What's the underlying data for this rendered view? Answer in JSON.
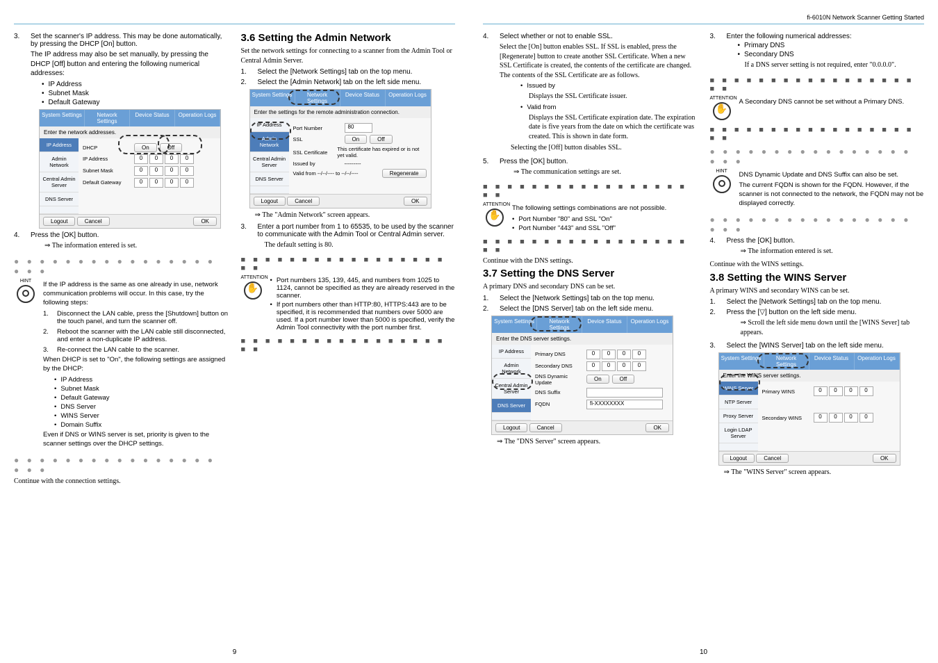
{
  "header_right": "fi-6010N Network Scanner Getting Started",
  "page_left_num": "9",
  "page_right_num": "10",
  "L": {
    "step3": "Set the scanner's IP address. This may be done automatically, by pressing the DHCP [On] button.",
    "step3_2": "The IP address may also be set manually, by pressing the DHCP [Off] button and entering the following numerical addresses:",
    "b_ip": "IP Address",
    "b_sm": "Subnet Mask",
    "b_dg": "Default Gateway",
    "ui1": {
      "tabs": [
        "System Settings",
        "Network Settings",
        "Device Status",
        "Operation Logs"
      ],
      "barmsg": "Enter the network addresses.",
      "side": [
        "IP Address",
        "Admin Network",
        "Central Admin Server",
        "DNS Server"
      ],
      "rows": {
        "dhcp": "DHCP",
        "on": "On",
        "off": "Off",
        "ipaddr": "IP Address",
        "subnet": "Subnet Mask",
        "defgw": "Default Gateway"
      },
      "logout": "Logout",
      "cancel": "Cancel",
      "ok": "OK",
      "zero": "0"
    },
    "step4": "Press the [OK] button.",
    "step4_arrow": "⇒ The information entered is set.",
    "hint_intro": "If the IP address is the same as one already in use, network communication problems will occur. In this case, try the following steps:",
    "hint1": "Disconnect the LAN cable, press the [Shutdown] button on the touch panel, and turn the scanner off.",
    "hint2": "Reboot the scanner with the LAN cable still disconnected, and enter a non-duplicate IP address.",
    "hint3": "Re-connect the LAN cable to the scanner.",
    "hint_d": "When DHCP is set to \"On\", the following settings are assigned by the DHCP:",
    "hb": [
      "IP Address",
      "Subnet Mask",
      "Default Gateway",
      "DNS Server",
      "WINS Server",
      "Domain Suffix"
    ],
    "hint_e": "Even if DNS or WINS server is set, priority is given to the scanner settings over the DHCP settings.",
    "cont1": "Continue with the connection settings.",
    "h36": "3.6  Setting the Admin Network",
    "h36_intro": "Set the network settings for connecting to a scanner from the Admin Tool or Central Admin Server.",
    "h36_s1": "Select the [Network Settings] tab on the top menu.",
    "h36_s2": "Select the [Admin Network] tab on the left side menu.",
    "ui2": {
      "barmsg": "Enter the settings for the remote administration connection.",
      "port": "Port Number",
      "port_v": "80",
      "ssl": "SSL",
      "on": "On",
      "off": "Off",
      "sslcert": "SSL Certificate",
      "sslcert_v": "This certificate has expired or is not yet valid.",
      "issued": "Issued by",
      "issued_v": "---------",
      "valid": "Valid from   --/--/----   to   --/--/----",
      "regen": "Regenerate"
    },
    "ui2_arrow": "⇒ The \"Admin Network\" screen appears.",
    "h36_s3": "Enter a port number from 1 to 65535, to be used by the scanner to communicate with the Admin Tool or Central Admin server.",
    "h36_def": "The default setting is 80.",
    "att1": "Port numbers 135, 139, 445, and numbers from 1025 to 1124, cannot be specified as they are already reserved in the scanner.",
    "att2": "If port numbers other than HTTP:80, HTTPS:443 are to be specified, it is recommended that numbers over 5000 are used. If a port number lower than 5000 is specified, verify the Admin Tool connectivity with the port number first."
  },
  "R": {
    "step4": "Select whether or not to enable SSL.",
    "step4_a": "Select the [On] button enables SSL. If SSL is enabled, press the [Regenerate] button to create another SSL Certificate. When a new SSL Certificate is created, the contents of the certificate are changed. The contents of the SSL Certificate are as follows.",
    "b_iss": "Issued by",
    "b_iss_t": "Displays the SSL Certificate issuer.",
    "b_val": "Valid from",
    "b_val_t": "Displays the SSL Certificate expiration date. The expiration date is five years from the date on which the certificate was created. This is shown in date form.",
    "sel_off": "Selecting the [Off] button disables SSL.",
    "step5": "Press the [OK] button.",
    "step5_arrow": "⇒ The communication settings are set.",
    "att_c": "The following settings combinations are not possible.",
    "att_c1": "Port Number \"80\" and SSL \"On\"",
    "att_c2": "Port Number \"443\" and SSL \"Off\"",
    "cont_dns": "Continue with the DNS settings.",
    "h37": "3.7  Setting the DNS Server",
    "h37_intro": "A primary DNS and secondary DNS can be set.",
    "h37_s1": "Select the [Network Settings] tab on the top menu.",
    "h37_s2": "Select the [DNS Server] tab on the left side menu.",
    "ui3": {
      "barmsg": "Enter the DNS server settings.",
      "pri": "Primary DNS",
      "sec": "Secondary DNS",
      "dyn": "DNS Dynamic Update",
      "on": "On",
      "off": "Off",
      "suf": "DNS Suffix",
      "fqdn": "FQDN",
      "fqdn_v": "fi-XXXXXXXX",
      "zero": "0"
    },
    "ui3_arrow": "⇒ The \"DNS Server\" screen appears.",
    "r_step3": "Enter the following numerical addresses:",
    "r_b_pri": "Primary DNS",
    "r_b_sec": "Secondary DNS",
    "r_b_sec_t": "If a DNS server setting is not required, enter \"0.0.0.0\".",
    "r_att_sec": "A Secondary DNS cannot be set without a Primary DNS.",
    "r_hint": "DNS Dynamic Update and DNS Suffix can also be set.",
    "r_hint2": "The current FQDN is shown for the FQDN. However, if the scanner is not connected to the network, the FQDN may not be displayed correctly.",
    "r_step4": "Press the [OK] button.",
    "r_step4_arrow": "⇒ The information entered is set.",
    "cont_wins": "Continue with the WINS settings.",
    "h38": "3.8  Setting the WINS Server",
    "h38_intro": "A primary WINS and secondary WINS can be set.",
    "h38_s1": "Select the [Network Settings] tab on the top menu.",
    "h38_s2": "Press the [▽] button on the left side menu.",
    "h38_s2_a": "⇒ Scroll the left side menu down until the [WINS Sever] tab appears.",
    "h38_s3": "Select the [WINS Server] tab on the left side menu.",
    "ui4": {
      "barmsg": "Enter the WINS server settings.",
      "side": [
        "WINS Server",
        "NTP Server",
        "Proxy Server",
        "Login LDAP Server"
      ],
      "pri": "Primary WINS",
      "sec": "Secondary WINS",
      "zero": "0"
    },
    "ui4_arrow": "⇒ The \"WINS Server\" screen appears."
  },
  "labels": {
    "hint": "HINT",
    "attention": "ATTENTION"
  }
}
